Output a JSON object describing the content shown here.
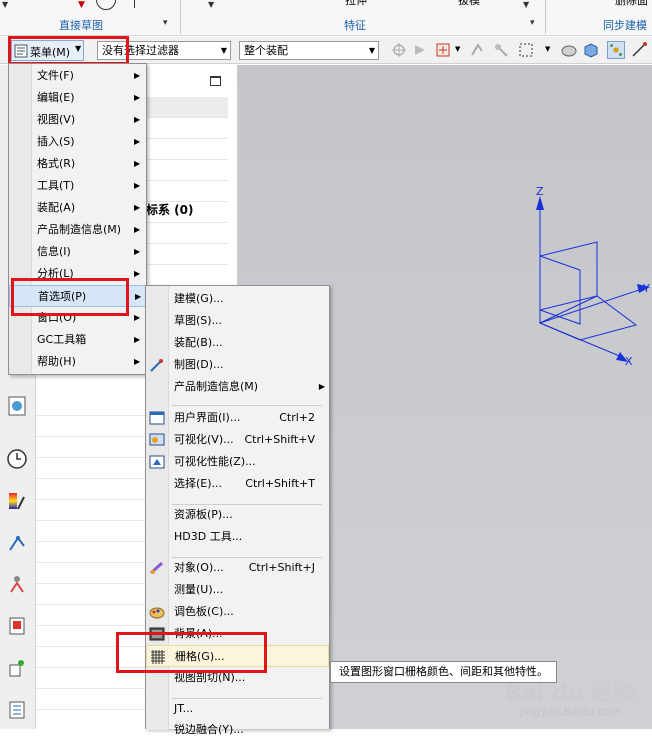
{
  "ribbon": {
    "groups": [
      "直接草图",
      "特征",
      "同步建模"
    ],
    "clipped_labels": [
      "拉伸",
      "拔模",
      "删除面"
    ]
  },
  "toolbar": {
    "menu_button": "菜单(M)",
    "filter_placeholder": "没有选择过滤器",
    "assembly_scope": "整个装配"
  },
  "navigator": {
    "header_icon": "maximize-icon",
    "visible_text": [
      "标系 (0)"
    ]
  },
  "main_menu": [
    {
      "label": "文件(F)",
      "has_sub": true
    },
    {
      "label": "编辑(E)",
      "has_sub": true
    },
    {
      "label": "视图(V)",
      "has_sub": true
    },
    {
      "label": "插入(S)",
      "has_sub": true
    },
    {
      "label": "格式(R)",
      "has_sub": true
    },
    {
      "label": "工具(T)",
      "has_sub": true
    },
    {
      "label": "装配(A)",
      "has_sub": true
    },
    {
      "label": "产品制造信息(M)",
      "has_sub": true
    },
    {
      "label": "信息(I)",
      "has_sub": true
    },
    {
      "label": "分析(L)",
      "has_sub": true
    },
    {
      "label": "首选项(P)",
      "has_sub": true
    },
    {
      "label": "窗口(O)",
      "has_sub": true
    },
    {
      "label": "GC工具箱",
      "has_sub": true
    },
    {
      "label": "帮助(H)",
      "has_sub": true
    }
  ],
  "prefs_menu": [
    {
      "label": "建模(G)...",
      "shortcut": ""
    },
    {
      "label": "草图(S)...",
      "shortcut": ""
    },
    {
      "label": "装配(B)...",
      "shortcut": ""
    },
    {
      "label": "制图(D)...",
      "shortcut": ""
    },
    {
      "label": "产品制造信息(M)",
      "shortcut": "",
      "has_sub": true
    },
    {
      "label": "用户界面(I)...",
      "shortcut": "Ctrl+2"
    },
    {
      "label": "可视化(V)...",
      "shortcut": "Ctrl+Shift+V"
    },
    {
      "label": "可视化性能(Z)...",
      "shortcut": ""
    },
    {
      "label": "选择(E)...",
      "shortcut": "Ctrl+Shift+T"
    },
    {
      "label": "资源板(P)...",
      "shortcut": ""
    },
    {
      "label": "HD3D 工具...",
      "shortcut": ""
    },
    {
      "label": "对象(O)...",
      "shortcut": "Ctrl+Shift+J"
    },
    {
      "label": "测量(U)...",
      "shortcut": ""
    },
    {
      "label": "调色板(C)...",
      "shortcut": ""
    },
    {
      "label": "背景(A)...",
      "shortcut": ""
    },
    {
      "label": "栅格(G)...",
      "shortcut": ""
    },
    {
      "label": "视图剖切(N)...",
      "shortcut": ""
    },
    {
      "label": "JT...",
      "shortcut": ""
    },
    {
      "label": "锐边融合(Y)...",
      "shortcut": ""
    }
  ],
  "tooltip": "设置图形窗口栅格颜色、间距和其他特性。",
  "axes": {
    "z": "Z",
    "y": "Y",
    "x": "X"
  },
  "watermark": {
    "brand": "Bai du 经验",
    "url": "jingyan.baidu.com"
  },
  "colors": {
    "accent": "#1b5fad",
    "highlight": "#d7e6f7",
    "red_annotation": "#e1141b",
    "triad": "#1a2fd6"
  }
}
